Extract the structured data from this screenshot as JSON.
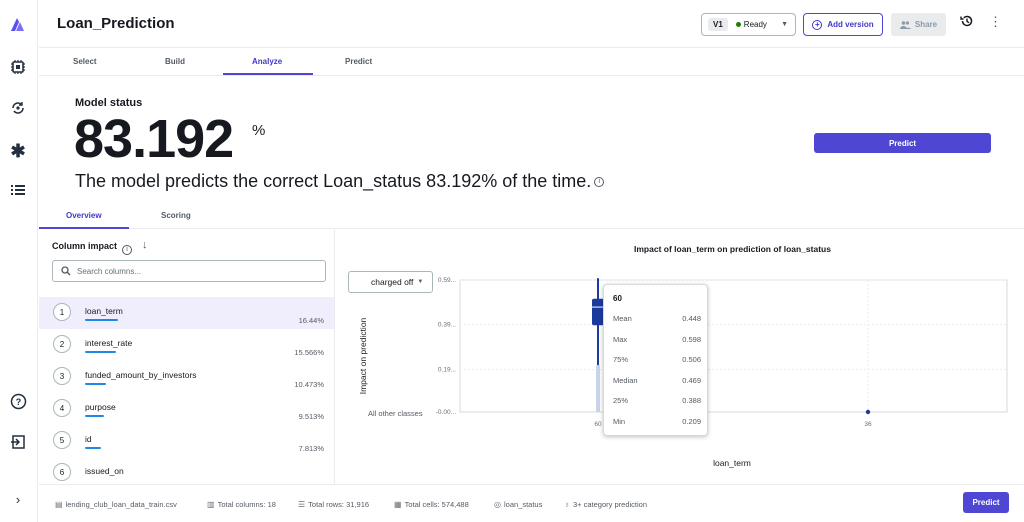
{
  "header": {
    "title": "Loan_Prediction",
    "version": "V1",
    "status": "Ready",
    "add_version": "Add version",
    "share": "Share"
  },
  "tabs": [
    "Select",
    "Build",
    "Analyze",
    "Predict"
  ],
  "model_status": {
    "label": "Model status",
    "accuracy": "83.192",
    "pct": "%",
    "description": "The model predicts the correct Loan_status 83.192% of the time.",
    "predict_button": "Predict"
  },
  "subtabs": [
    "Overview",
    "Scoring"
  ],
  "column_impact": {
    "title": "Column impact",
    "search_placeholder": "Search columns...",
    "items": [
      {
        "rank": "1",
        "name": "loan_term",
        "pct": "16.44%",
        "fraction": 0.1644
      },
      {
        "rank": "2",
        "name": "interest_rate",
        "pct": "15.566%",
        "fraction": 0.15566
      },
      {
        "rank": "3",
        "name": "funded_amount_by_investors",
        "pct": "10.473%",
        "fraction": 0.10473
      },
      {
        "rank": "4",
        "name": "purpose",
        "pct": "9.513%",
        "fraction": 0.09513
      },
      {
        "rank": "5",
        "name": "id",
        "pct": "7.813%",
        "fraction": 0.07813
      },
      {
        "rank": "6",
        "name": "issued_on",
        "pct": "",
        "fraction": 0
      }
    ]
  },
  "chart": {
    "title": "Impact of loan_term on prediction of loan_status",
    "class_select": "charged off",
    "ylabel": "Impact on prediction",
    "xlabel": "loan_term",
    "other_classes_label": "All other classes",
    "yticks": [
      "0.59...",
      "0.39...",
      "0.19...",
      "-0.00..."
    ],
    "xticks": [
      "60",
      "36"
    ]
  },
  "chart_data": {
    "type": "box",
    "title": "Impact of loan_term on prediction of loan_status",
    "xlabel": "loan_term",
    "ylabel": "Impact on prediction",
    "categories": [
      "60",
      "36"
    ],
    "boxes": [
      {
        "category": "60",
        "min": 0.209,
        "q1": 0.388,
        "median": 0.469,
        "q3": 0.506,
        "max": 0.598,
        "mean": 0.448
      },
      {
        "category": "36",
        "min": 0.0,
        "q1": 0.0,
        "median": 0.0,
        "q3": 0.0,
        "max": 0.0
      }
    ],
    "ylim": [
      0,
      0.59
    ],
    "color": "#1a3a9e"
  },
  "tooltip": {
    "title": "60",
    "rows": [
      {
        "label": "Mean",
        "value": "0.448"
      },
      {
        "label": "Max",
        "value": "0.598"
      },
      {
        "label": "75%",
        "value": "0.506"
      },
      {
        "label": "Median",
        "value": "0.469"
      },
      {
        "label": "25%",
        "value": "0.388"
      },
      {
        "label": "Min",
        "value": "0.209"
      }
    ]
  },
  "footer": {
    "file": "lending_club_loan_data_train.csv",
    "total_columns": "Total columns: 18",
    "total_rows": "Total rows: 31,916",
    "total_cells": "Total cells: 574,488",
    "target": "loan_status",
    "model_type": "3+ category prediction",
    "predict": "Predict"
  },
  "colors": {
    "accent": "#5046d4",
    "bar": "#1e88e5",
    "box": "#1a3a9e"
  }
}
